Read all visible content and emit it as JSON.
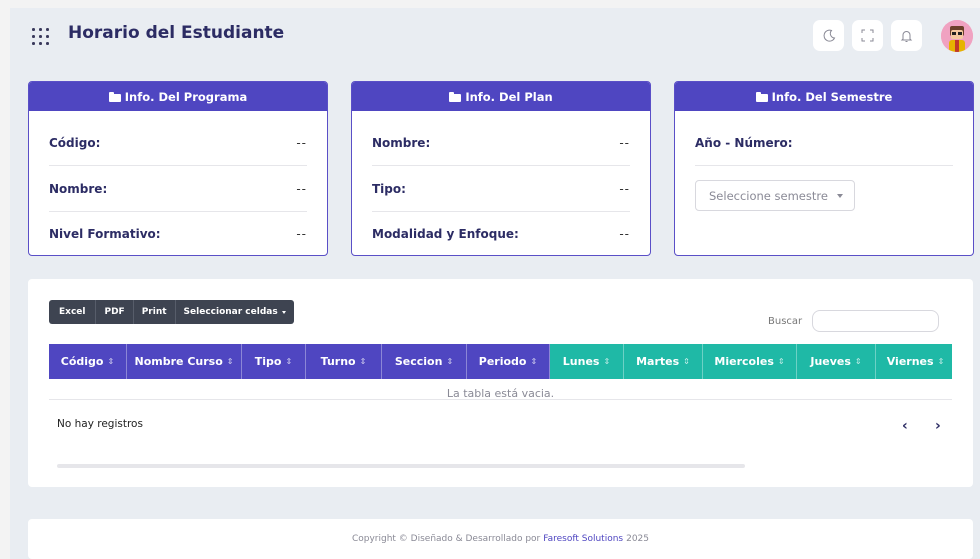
{
  "header": {
    "title": "Horario del Estudiante"
  },
  "cards": {
    "programa": {
      "title": "Info. Del Programa",
      "rows": [
        {
          "label": "Código:",
          "value": "--"
        },
        {
          "label": "Nombre:",
          "value": "--"
        },
        {
          "label": "Nivel Formativo:",
          "value": "--"
        }
      ]
    },
    "plan": {
      "title": "Info. Del Plan",
      "rows": [
        {
          "label": "Nombre:",
          "value": "--"
        },
        {
          "label": "Tipo:",
          "value": "--"
        },
        {
          "label": "Modalidad y Enfoque:",
          "value": "--"
        }
      ]
    },
    "semestre": {
      "title": "Info. Del Semestre",
      "label": "Año - Número:",
      "select_value": "Seleccione semestre"
    }
  },
  "table": {
    "toolbar": [
      "Excel",
      "PDF",
      "Print",
      "Seleccionar celdas"
    ],
    "search_label": "Buscar",
    "search_value": "",
    "columns": [
      "Código",
      "Nombre Curso",
      "Tipo",
      "Turno",
      "Seccion",
      "Periodo",
      "Lunes",
      "Martes",
      "Miercoles",
      "Jueves",
      "Viernes"
    ],
    "rows": [],
    "empty_message": "La tabla está vacia.",
    "info": "No hay registros",
    "prev_label": "‹",
    "next_label": "›"
  },
  "footer": {
    "prefix": "Copyright © Diseñado & Desarrollado por",
    "brand": "Faresoft Solutions",
    "year": "2025"
  },
  "colors": {
    "primary": "#4f46c1",
    "teal": "#1fb9a6",
    "toolbar": "#3e4451"
  }
}
